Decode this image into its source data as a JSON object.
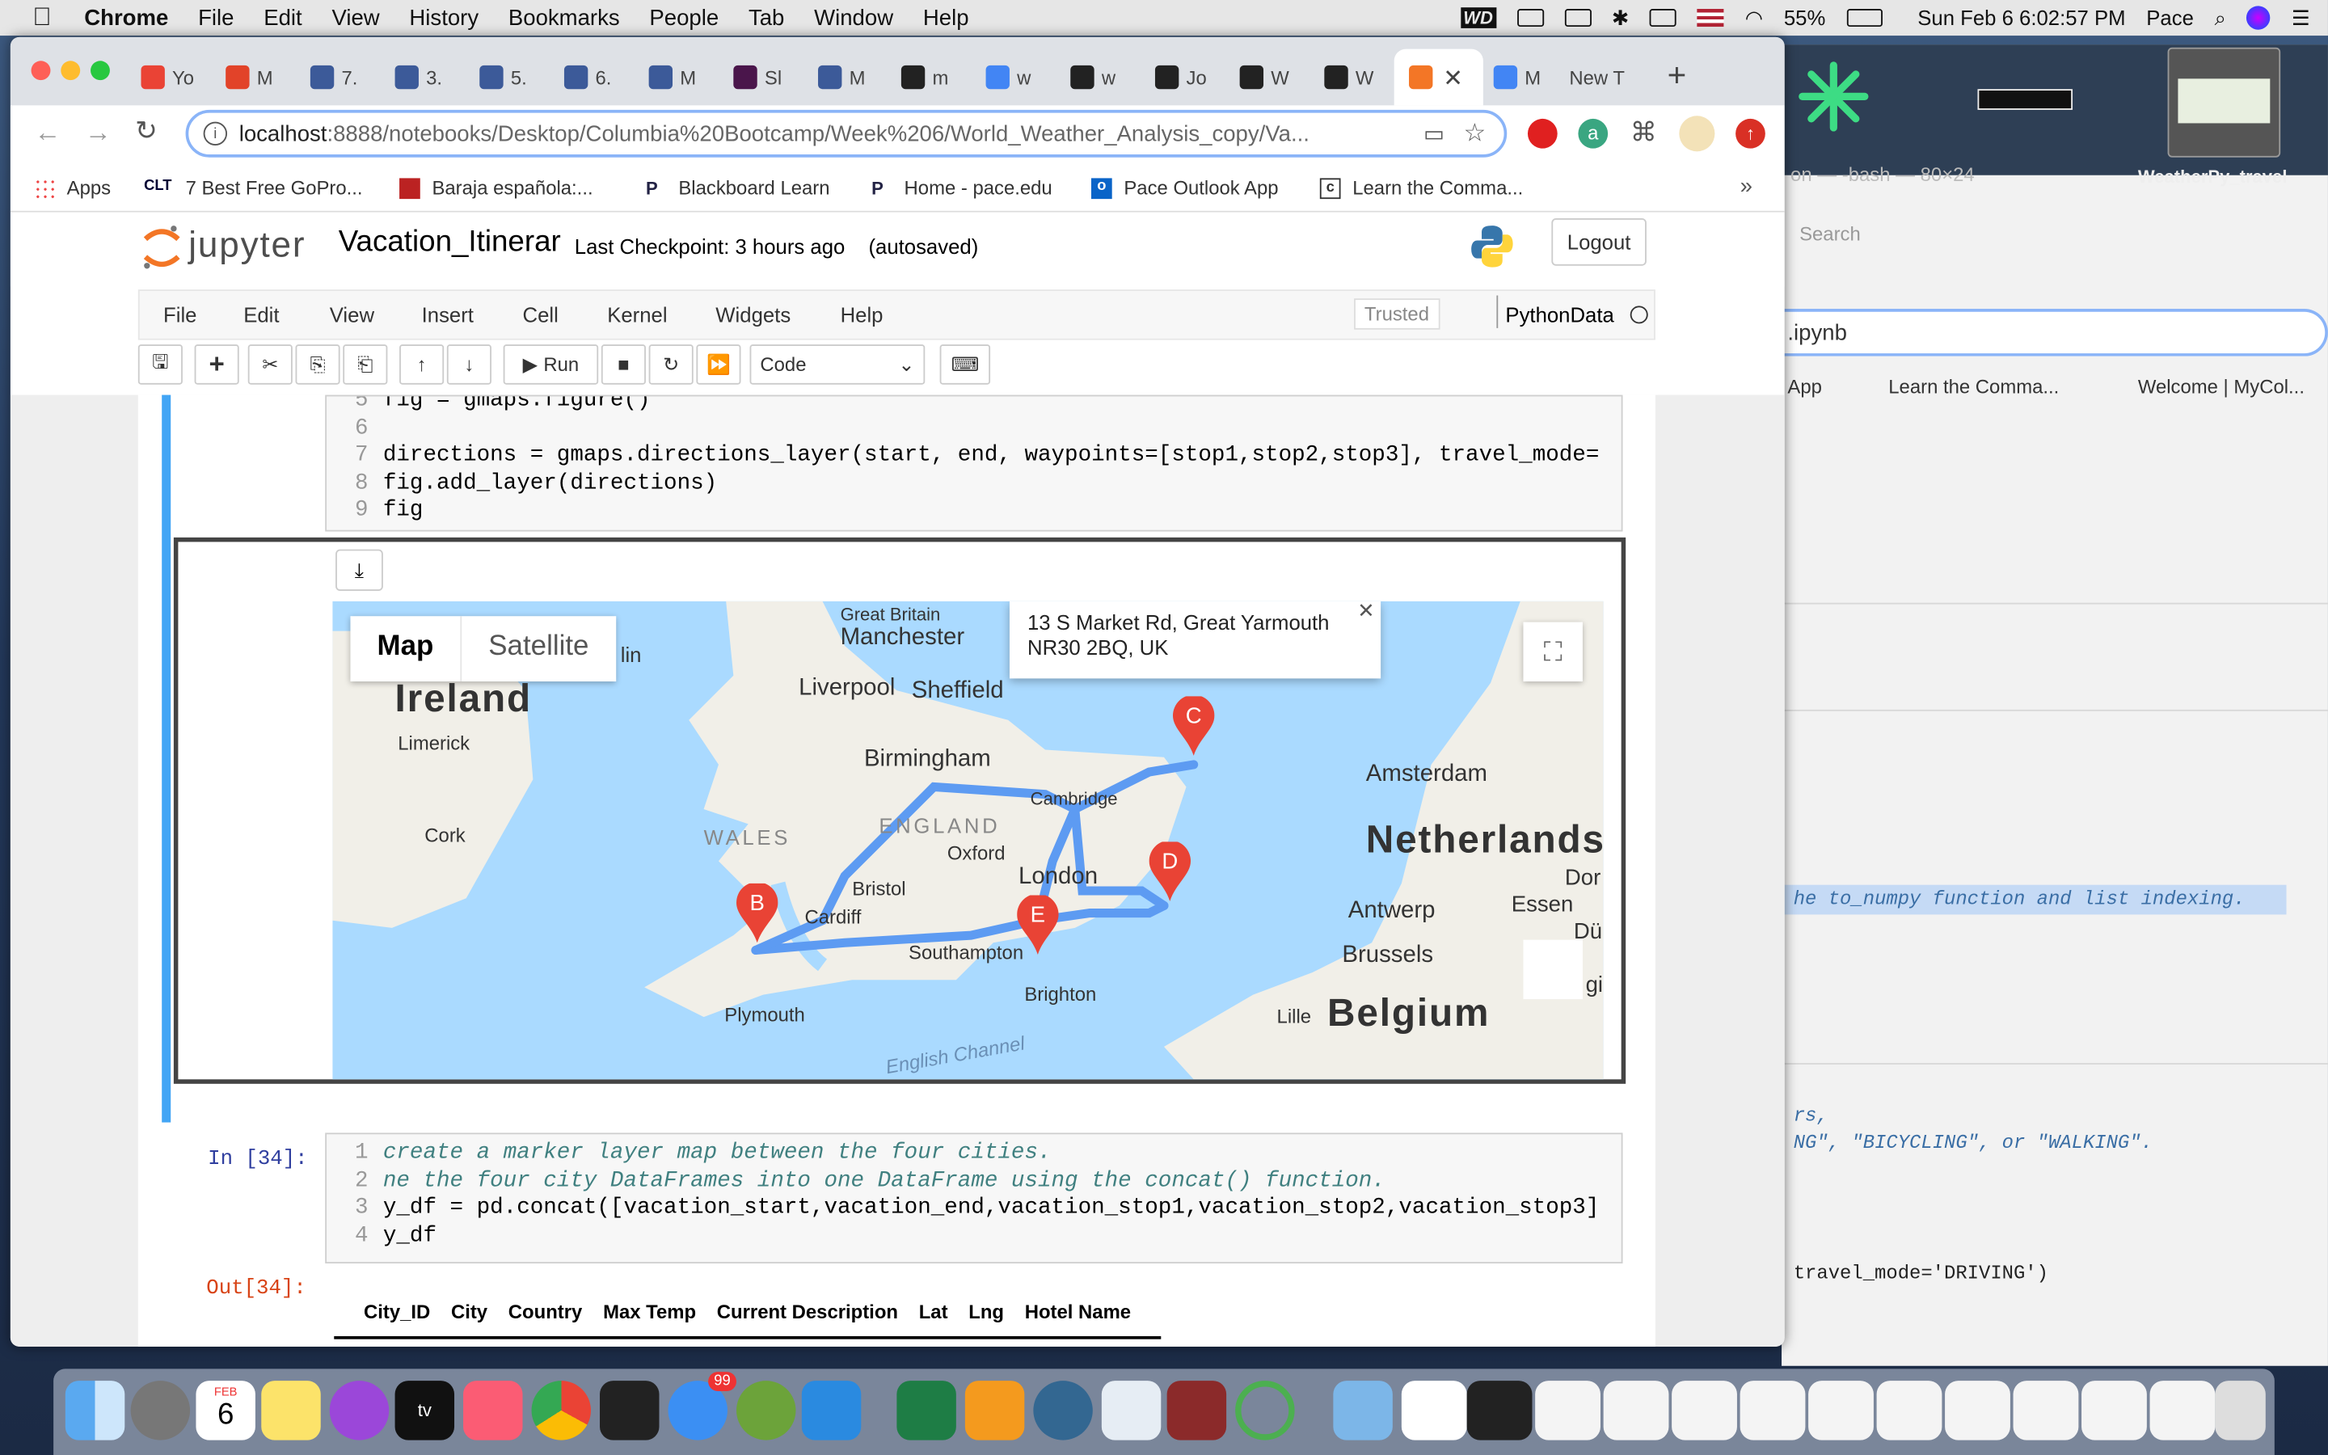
{
  "menubar": {
    "app": "Chrome",
    "items": [
      "File",
      "Edit",
      "View",
      "History",
      "Bookmarks",
      "People",
      "Tab",
      "Window",
      "Help"
    ],
    "battery": "55%",
    "datetime": "Sun Feb 6  6:02:57 PM",
    "user": "Pace"
  },
  "tabs": [
    {
      "icon": "gmail-icon",
      "label": "Yo",
      "color": "#ea4335"
    },
    {
      "icon": "gitlab-icon",
      "label": "M",
      "color": "#e24329"
    },
    {
      "icon": "jupyter-icon",
      "label": "7.",
      "color": "#3c5a99"
    },
    {
      "icon": "jupyter-icon",
      "label": "3.",
      "color": "#3c5a99"
    },
    {
      "icon": "jupyter-icon",
      "label": "5.",
      "color": "#3c5a99"
    },
    {
      "icon": "jupyter-icon",
      "label": "6.",
      "color": "#3c5a99"
    },
    {
      "icon": "jupyter-icon",
      "label": "M",
      "color": "#3c5a99"
    },
    {
      "icon": "slack-icon",
      "label": "Sl",
      "color": "#4a154b"
    },
    {
      "icon": "jupyter-icon",
      "label": "M",
      "color": "#3c5a99"
    },
    {
      "icon": "github-icon",
      "label": "m",
      "color": "#222"
    },
    {
      "icon": "google-icon",
      "label": "w",
      "color": "#4285f4"
    },
    {
      "icon": "github-icon",
      "label": "w",
      "color": "#222"
    },
    {
      "icon": "github-icon",
      "label": "Jo",
      "color": "#222"
    },
    {
      "icon": "github-icon",
      "label": "W",
      "color": "#222"
    },
    {
      "icon": "github-icon",
      "label": "W",
      "color": "#222"
    },
    {
      "icon": "jupyter-orange-icon",
      "label": "",
      "color": "#f37626"
    },
    {
      "icon": "google-icon",
      "label": "M",
      "color": "#4285f4"
    },
    {
      "icon": "",
      "label": "New T",
      "color": "#999"
    }
  ],
  "url": {
    "host": "localhost",
    "rest": ":8888/notebooks/Desktop/Columbia%20Bootcamp/Week%206/World_Weather_Analysis_copy/Va..."
  },
  "bookmarks": [
    {
      "icon": "apps-icon",
      "label": "Apps"
    },
    {
      "icon": "clt-icon",
      "label": "7 Best Free GoPro..."
    },
    {
      "icon": "baraja-icon",
      "label": "Baraja española:..."
    },
    {
      "icon": "blackboard-icon",
      "label": "Blackboard Learn"
    },
    {
      "icon": "pace-icon",
      "label": "Home - pace.edu"
    },
    {
      "icon": "outlook-icon",
      "label": "Pace Outlook App"
    },
    {
      "icon": "cmd-icon",
      "label": "Learn the Comma..."
    }
  ],
  "jupyter": {
    "logo": "jupyter",
    "title": "Vacation_Itinerar",
    "checkpoint": "Last Checkpoint: 3 hours ago",
    "saved": "(autosaved)",
    "logout": "Logout",
    "menu": [
      "File",
      "Edit",
      "View",
      "Insert",
      "Cell",
      "Kernel",
      "Widgets",
      "Help"
    ],
    "trusted": "Trusted",
    "kernel": "PythonData",
    "run": "Run",
    "celltype": "Code"
  },
  "cell1": {
    "lines": [
      {
        "n": "5",
        "code": "fig = gmaps.figure()"
      },
      {
        "n": "6",
        "code": ""
      },
      {
        "n": "7",
        "code": "directions = gmaps.directions_layer(start, end, waypoints=[stop1,stop2,stop3], travel_mode="
      },
      {
        "n": "8",
        "code": "fig.add_layer(directions)"
      },
      {
        "n": "9",
        "code": "fig"
      }
    ]
  },
  "map": {
    "tab_map": "Map",
    "tab_satellite": "Satellite",
    "info_line1": "13 S Market Rd, Great Yarmouth",
    "info_line2": "NR30 2BQ, UK",
    "labels": {
      "great_britain": "Great Britain",
      "manchester": "Manchester",
      "liverpool": "Liverpool",
      "sheffield": "Sheffield",
      "ireland": "Ireland",
      "limerick": "Limerick",
      "cork": "Cork",
      "birmingham": "Birmingham",
      "wales": "WALES",
      "england": "ENGLAND",
      "cambridge": "Cambridge",
      "oxford": "Oxford",
      "london": "London",
      "bristol": "Bristol",
      "cardiff": "Cardiff",
      "southampton": "Southampton",
      "brighton": "Brighton",
      "plymouth": "Plymouth",
      "english_channel": "English Channel",
      "amsterdam": "Amsterdam",
      "netherlands": "Netherlands",
      "antwerp": "Antwerp",
      "brussels": "Brussels",
      "essen": "Essen",
      "belgium": "Belgium",
      "lille": "Lille",
      "dublin_frag": "lin",
      "dor": "Dor",
      "du": "Dü",
      "gi": "gi"
    },
    "pins": [
      "B",
      "C",
      "D",
      "E"
    ]
  },
  "cell2": {
    "prompt": "In [34]:",
    "lines": [
      {
        "n": "1",
        "code": "create a marker layer map between the four cities.",
        "comment": true
      },
      {
        "n": "2",
        "code": "ne the four city DataFrames into one DataFrame using the concat() function.",
        "comment": true
      },
      {
        "n": "3",
        "code": "y_df = pd.concat([vacation_start,vacation_end,vacation_stop1,vacation_stop2,vacation_stop3]",
        "comment": false
      },
      {
        "n": "4",
        "code": "y_df",
        "comment": false
      }
    ]
  },
  "out34": {
    "prompt": "Out[34]:",
    "columns": [
      "City_ID",
      "City",
      "Country",
      "Max Temp",
      "Current Description",
      "Lat",
      "Lng",
      "Hotel Name"
    ]
  },
  "backwin": {
    "term": "on — -bash — 80×24",
    "weather": "WeatherPy_travel",
    "search": "Search",
    "file": ".ipynb",
    "bm1": "App",
    "bm2": "Learn the Comma...",
    "bm3": "Welcome | MyCol...",
    "hl": "he to_numpy function and list indexing.",
    "t1": "rs,",
    "t2": "NG\", \"BICYCLING\", or \"WALKING\".",
    "t3": "travel_mode='DRIVING')"
  },
  "dock": {
    "calendar_month": "FEB",
    "calendar_day": "6",
    "badge": "99"
  }
}
